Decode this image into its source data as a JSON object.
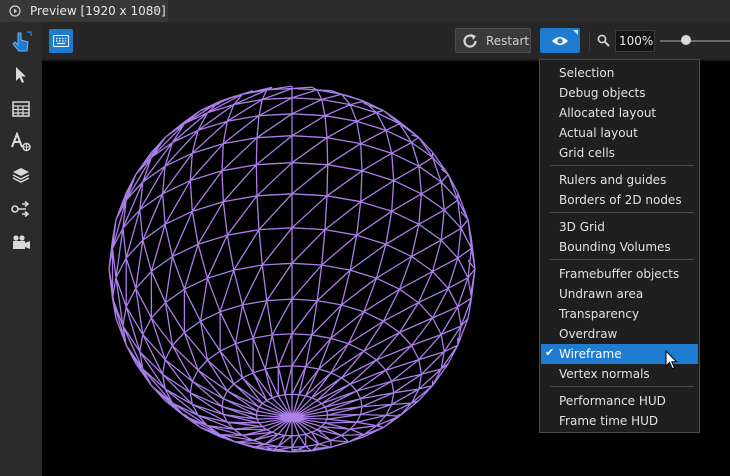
{
  "tab": {
    "title": "Preview [1920 x 1080]",
    "close": "✕"
  },
  "toolbar": {
    "restart_label": "Restart",
    "zoom_value": "100%",
    "zoom_level": 0.3
  },
  "tools": [
    "pointer-hand-icon",
    "select-arrow-icon",
    "grid-layout-icon",
    "text-style-icon",
    "layers-icon",
    "connect-icon",
    "camera-icon"
  ],
  "menu": {
    "groups": [
      [
        "Selection",
        "Debug objects",
        "Allocated layout",
        "Actual layout",
        "Grid cells"
      ],
      [
        "Rulers and guides",
        "Borders of 2D nodes"
      ],
      [
        "3D Grid",
        "Bounding Volumes"
      ],
      [
        "Framebuffer objects",
        "Undrawn area",
        "Transparency",
        "Overdraw",
        "Wireframe",
        "Vertex normals"
      ],
      [
        "Performance HUD",
        "Frame time HUD"
      ]
    ],
    "checked": "Wireframe",
    "check_glyph": "✔"
  },
  "colors": {
    "accent": "#1e7cd0",
    "wireframe": "#a97ee8",
    "viewport_bg": "#000000"
  }
}
